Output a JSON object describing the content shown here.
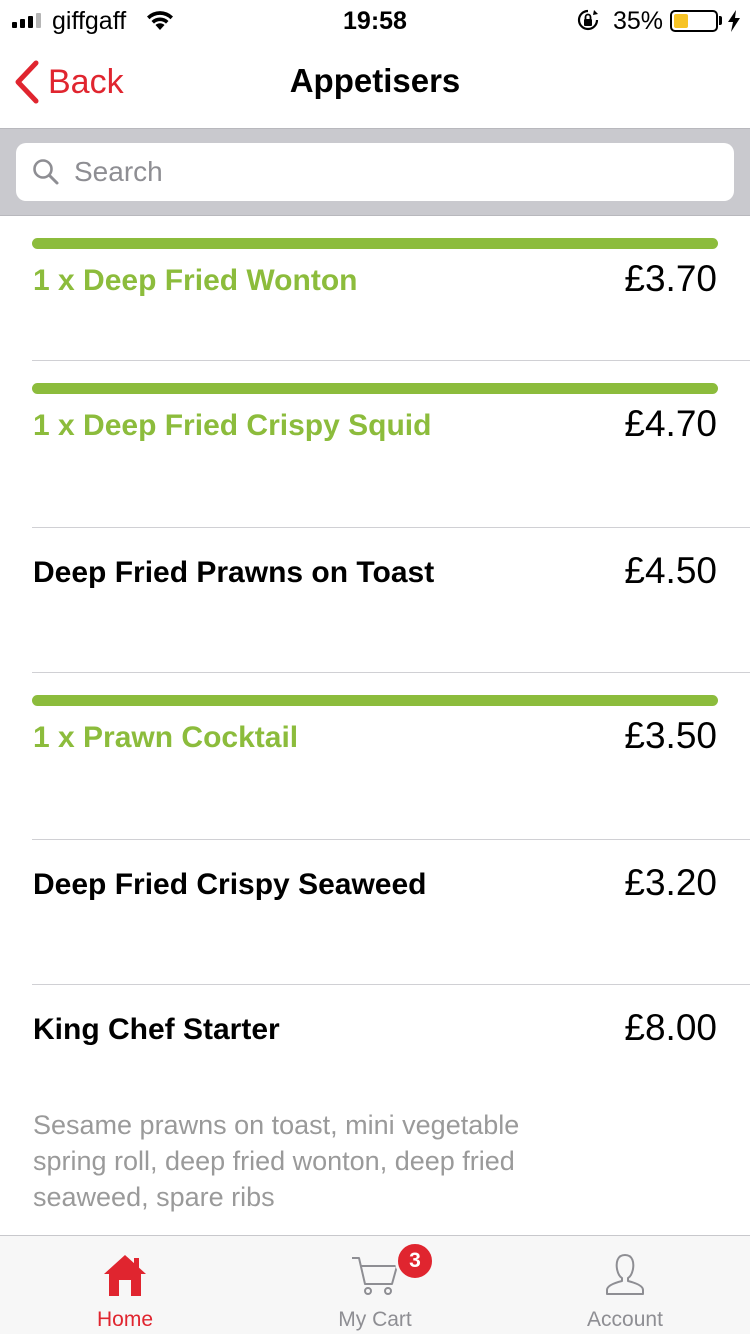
{
  "status_bar": {
    "carrier": "giffgaff",
    "time": "19:58",
    "battery_percent_label": "35%",
    "battery_level": 0.35,
    "signal_bars_filled": 3,
    "signal_bars_total": 4,
    "icons": [
      "signal-icon",
      "wifi-icon",
      "rotation-lock-icon",
      "battery-icon",
      "charging-bolt-icon"
    ]
  },
  "nav": {
    "back_label": "Back",
    "title": "Appetisers",
    "accent_color": "#e0252f"
  },
  "search": {
    "placeholder": "Search",
    "value": ""
  },
  "menu": {
    "in_cart_color": "#8cbc3c",
    "items": [
      {
        "name": "1 x Deep Fried Wonton",
        "price": "£3.70",
        "in_cart": true
      },
      {
        "name": "1 x Deep Fried Crispy Squid",
        "price": "£4.70",
        "in_cart": true
      },
      {
        "name": "Deep Fried Prawns on Toast",
        "price": "£4.50",
        "in_cart": false
      },
      {
        "name": "1 x Prawn Cocktail",
        "price": "£3.50",
        "in_cart": true
      },
      {
        "name": "Deep Fried Crispy Seaweed",
        "price": "£3.20",
        "in_cart": false
      },
      {
        "name": "King Chef Starter",
        "price": "£8.00",
        "in_cart": false,
        "description": "Sesame prawns on toast, mini vegetable spring roll, deep fried wonton, deep fried seaweed, spare ribs"
      }
    ]
  },
  "tabs": [
    {
      "label": "Home",
      "icon": "home-icon",
      "active": true
    },
    {
      "label": "My Cart",
      "icon": "cart-icon",
      "active": false,
      "badge": "3"
    },
    {
      "label": "Account",
      "icon": "account-icon",
      "active": false
    }
  ]
}
